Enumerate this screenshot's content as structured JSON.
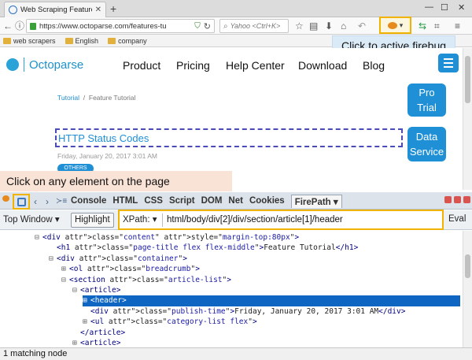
{
  "browser": {
    "tab": {
      "title": "Web Scraping Features Tu"
    },
    "url": "https://www.octoparse.com/features-tu",
    "search_placeholder": "Yahoo <Ctrl+K>",
    "bookmarks": [
      "web scrapers",
      "English",
      "company"
    ]
  },
  "callouts": {
    "firebug": "Click to active firebug",
    "click_element": "Click on any element on the page"
  },
  "page": {
    "logo_text": "Octoparse",
    "menu": [
      "Product",
      "Pricing",
      "Help Center",
      "Download",
      "Blog"
    ],
    "breadcrumb": [
      "Tutorial",
      "Feature Tutorial"
    ],
    "side_buttons": [
      {
        "label_1": "Pro",
        "label_2": "Trial"
      },
      {
        "label_1": "Data",
        "label_2": "Service"
      }
    ],
    "article_title": "HTTP Status Codes",
    "publish_time": "Friday, January 20, 2017 3:01 AM",
    "badge": "OTHERS"
  },
  "firebug": {
    "tabs": [
      "Console",
      "HTML",
      "CSS",
      "Script",
      "DOM",
      "Net",
      "Cookies",
      "FirePath"
    ],
    "active_tab": "FirePath",
    "window_select": "Top Window",
    "highlight_button": "Highlight",
    "xpath_label": "XPath:",
    "xpath_value": "html/body/div[2]/div/section/article[1]/header",
    "eval_button": "Eval",
    "status": "1 matching node"
  },
  "dom_tree": [
    {
      "t": "<div  class=\"content\"  style=\"margin-top:80px\">",
      "tw": "−",
      "indent": 44
    },
    {
      "t": "<h1  class=\"page-title flex flex-middle\">Feature  Tutorial</h1>",
      "tw": "",
      "indent": 62
    },
    {
      "t": "<div  class=\"container\">",
      "tw": "−",
      "indent": 62
    },
    {
      "t": "<ol  class=\"breadcrumb\">",
      "tw": "+",
      "indent": 78
    },
    {
      "t": "<section  class=\"article-list\">",
      "tw": "−",
      "indent": 78
    },
    {
      "t": "<article>",
      "tw": "−",
      "indent": 92
    },
    {
      "t": "<header>",
      "tw": "+",
      "indent": 105,
      "selected": true
    },
    {
      "t": "<div  class=\"publish-time\">Friday,  January 20, 2017 3:01 AM</div>",
      "tw": "",
      "indent": 105
    },
    {
      "t": "<ul  class=\"category-list flex\">",
      "tw": "+",
      "indent": 105
    },
    {
      "t": "</article>",
      "tw": "",
      "indent": 92
    },
    {
      "t": "<article>",
      "tw": "+",
      "indent": 92
    }
  ]
}
